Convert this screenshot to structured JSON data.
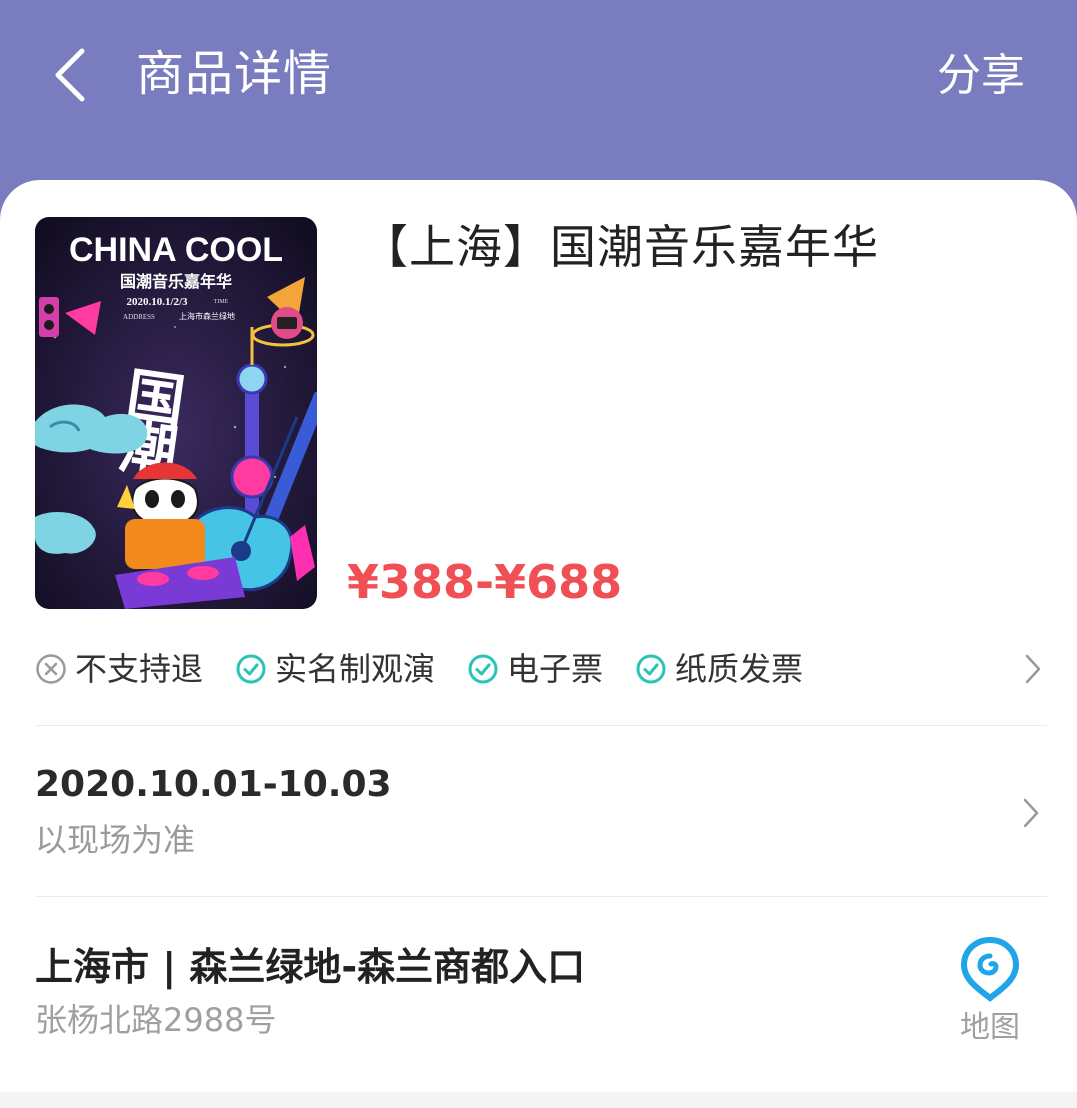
{
  "header": {
    "title": "商品详情",
    "share_label": "分享",
    "back_icon": "chevron-left-icon",
    "background_color": "#797cbf"
  },
  "product": {
    "title": "【上海】国潮音乐嘉年华",
    "price": "¥388-¥688",
    "price_color": "#ef4f55",
    "poster": {
      "headline": "CHINA COOL",
      "subtitle": "国潮音乐嘉年华",
      "dates": "2020.10.1/2/3",
      "time_label": "TIME",
      "address_label": "ADDRESS",
      "address": "上海市森兰绿地",
      "calligraphy": "国潮"
    }
  },
  "tags": [
    {
      "label": "不支持退",
      "icon": "x-circle-icon",
      "color": "#9a9a9a"
    },
    {
      "label": "实名制观演",
      "icon": "check-circle-icon",
      "color": "#2ac3b8"
    },
    {
      "label": "电子票",
      "icon": "check-circle-icon",
      "color": "#2ac3b8"
    },
    {
      "label": "纸质发票",
      "icon": "check-circle-icon",
      "color": "#2ac3b8"
    }
  ],
  "schedule": {
    "date_range": "2020.10.01-10.03",
    "note": "以现场为准"
  },
  "venue": {
    "name": "上海市 | 森兰绿地-森兰商都入口",
    "address": "张杨北路2988号",
    "map_label": "地图",
    "map_icon_color": "#1fa5e8"
  }
}
